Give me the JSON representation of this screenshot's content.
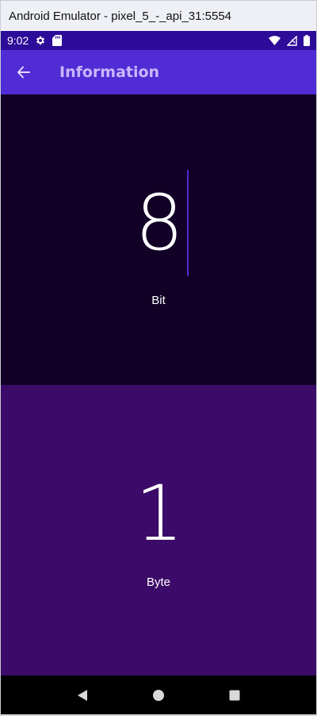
{
  "emulator": {
    "title": "Android Emulator - pixel_5_-_api_31:5554"
  },
  "status_bar": {
    "time": "9:02",
    "icons": [
      "settings-gear-icon",
      "sd-card-icon",
      "wifi-icon",
      "no-signal-icon",
      "battery-icon"
    ]
  },
  "app_bar": {
    "title": "Information",
    "back_icon": "arrow-left-icon"
  },
  "converter": {
    "bit": {
      "value": "8",
      "unit": "Bit",
      "background": "#120026"
    },
    "byte": {
      "value": "1",
      "unit": "Byte",
      "background": "#3c0b69"
    }
  },
  "nav_bar": {
    "buttons": [
      "back-triangle-icon",
      "home-circle-icon",
      "recents-square-icon"
    ]
  },
  "colors": {
    "status_bar": "#2d0c99",
    "app_bar": "#512bd4",
    "app_title": "#c7b8ff",
    "caret": "#512bd4"
  }
}
